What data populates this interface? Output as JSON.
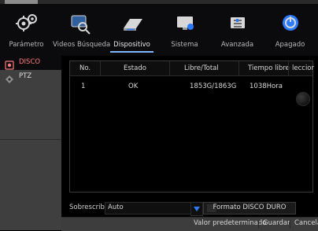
{
  "nav": {
    "items": [
      {
        "label": "Parámetro"
      },
      {
        "label": "Videos Búsqueda"
      },
      {
        "label": "Dispositivo"
      },
      {
        "label": "Sistema"
      },
      {
        "label": "Avanzada"
      },
      {
        "label": "Apagado"
      }
    ],
    "active_index": 2
  },
  "sidebar": {
    "items": [
      {
        "label": "DISCO",
        "active": true
      },
      {
        "label": "PTZ",
        "active": false
      }
    ]
  },
  "table": {
    "headers": {
      "no": "No.",
      "estado": "Estado",
      "libre_total": "Libre/Total",
      "tiempo_libre": "Tiempo libre",
      "seleccion": "leccior"
    },
    "rows": [
      {
        "no": "1",
        "estado": "OK",
        "libre_total": "1853G/1863G",
        "tiempo_libre": "1038Hora"
      }
    ]
  },
  "overwrite": {
    "label": "Sobrescribir",
    "value": "Auto"
  },
  "actions": {
    "format": "Formato DISCO DURO",
    "default": "Valor predeterminado",
    "save": "Guardar",
    "cancel": "Cancelar"
  },
  "colors": {
    "accent_blue": "#2a7bff",
    "active_side_text": "#ff7a7a"
  }
}
